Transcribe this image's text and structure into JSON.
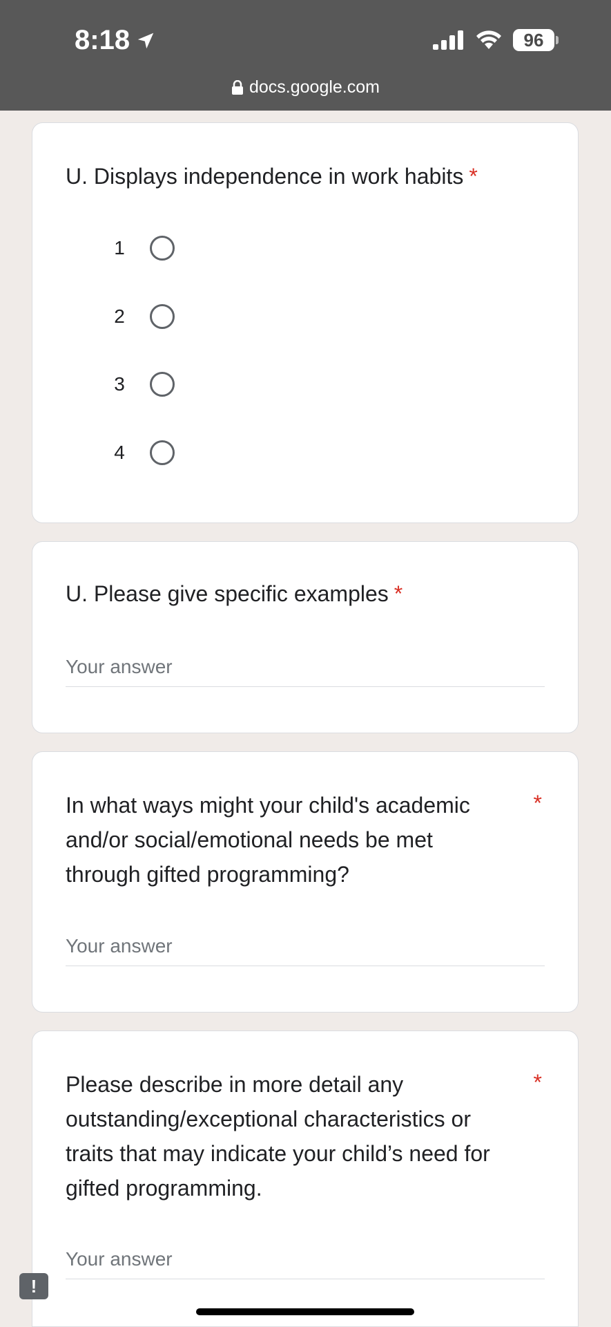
{
  "status_bar": {
    "time": "8:18",
    "battery": "96"
  },
  "browser": {
    "url": "docs.google.com"
  },
  "questions": [
    {
      "title": "U. Displays independence in work habits",
      "required_mark": "*",
      "options": [
        "1",
        "2",
        "3",
        "4"
      ]
    },
    {
      "title": "U. Please give specific examples",
      "required_mark": "*",
      "placeholder": "Your answer"
    },
    {
      "title": "In what ways might your child's academic and/or social/emotional needs be met through gifted programming?",
      "lines": [
        "In what ways might your child's academic",
        "and/or social/emotional needs be met",
        "through gifted programming?"
      ],
      "required_mark": "*",
      "placeholder": "Your answer"
    },
    {
      "title": "Please describe in more detail any outstanding/exceptional characteristics or traits that may indicate your child’s need for gifted programming.",
      "lines": [
        "Please describe in more detail any",
        "outstanding/exceptional characteristics or",
        "traits that may indicate your child’s need for",
        "gifted programming."
      ],
      "required_mark": "*",
      "placeholder": "Your answer"
    }
  ],
  "feedback_icon": {
    "glyph": "!"
  },
  "colors": {
    "required": "#d93025",
    "topbar": "#585858",
    "page_bg": "#f0ebe8"
  }
}
